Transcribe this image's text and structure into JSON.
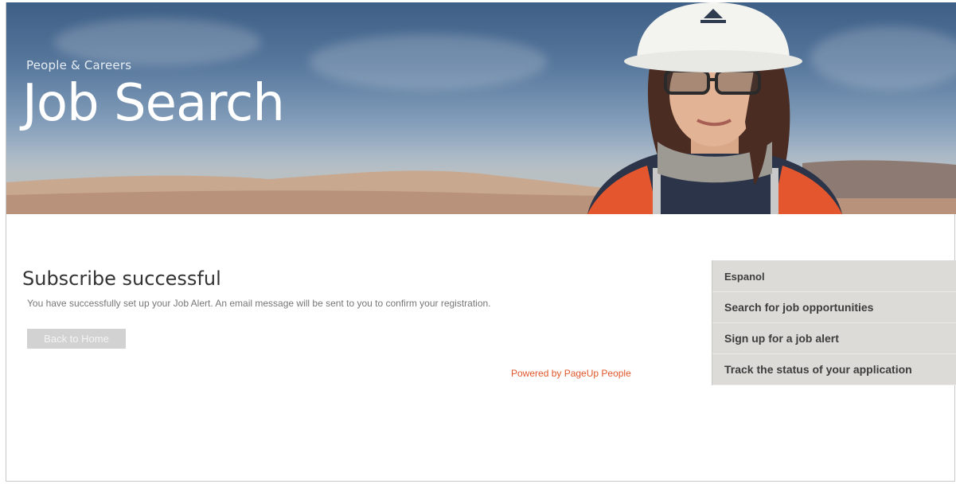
{
  "banner": {
    "kicker": "People & Careers",
    "title": "Job Search"
  },
  "content": {
    "title": "Subscribe successful",
    "message": "You have successfully set up your Job Alert. An email message will be sent to you to confirm your registration.",
    "back_button_label": "Back to Home",
    "powered_by": "Powered by PageUp People"
  },
  "sidebar": {
    "items": [
      {
        "label": "Espanol"
      },
      {
        "label": "Search for job opportunities"
      },
      {
        "label": "Sign up for a job alert"
      },
      {
        "label": "Track the status of your application"
      }
    ]
  },
  "colors": {
    "accent_link": "#e0572b",
    "sidebar_bg": "#dcdbd7",
    "button_bg": "#d2d2d2"
  }
}
